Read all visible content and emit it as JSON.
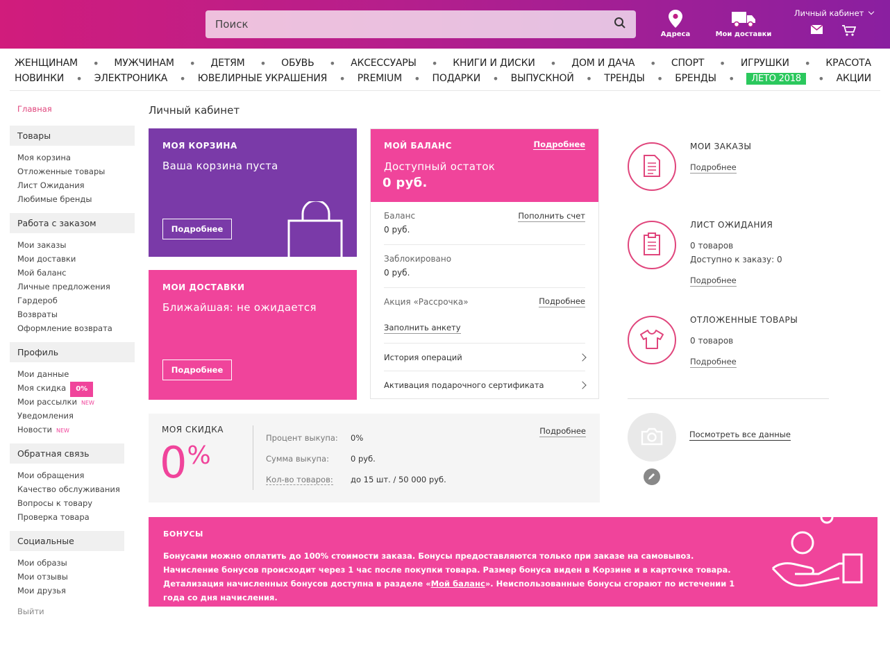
{
  "header": {
    "search_placeholder": "Поиск",
    "addresses_label": "Адреса",
    "deliveries_label": "Мои доставки",
    "account_label": "Личный кабинет"
  },
  "nav": {
    "row1": [
      "ЖЕНЩИНАМ",
      "МУЖЧИНАМ",
      "ДЕТЯМ",
      "ОБУВЬ",
      "АКСЕССУАРЫ",
      "КНИГИ И ДИСКИ",
      "ДОМ И ДАЧА",
      "СПОРТ",
      "ИГРУШКИ",
      "КРАСОТА"
    ],
    "row2": [
      "НОВИНКИ",
      "ЭЛЕКТРОНИКА",
      "ЮВЕЛИРНЫЕ УКРАШЕНИЯ",
      "PREMIUM",
      "ПОДАРКИ",
      "ВЫПУСКНОЙ",
      "ТРЕНДЫ",
      "БРЕНДЫ",
      "ЛЕТО 2018",
      "АКЦИИ"
    ]
  },
  "sidebar": {
    "home": "Главная",
    "sections": [
      {
        "title": "Товары",
        "items": [
          "Моя корзина",
          "Отложенные товары",
          "Лист Ожидания",
          "Любимые бренды"
        ]
      },
      {
        "title": "Работа с заказом",
        "items": [
          "Мои заказы",
          "Мои доставки",
          "Мой баланс",
          "Личные предложения",
          "Гардероб",
          "Возвраты",
          "Оформление возврата"
        ]
      },
      {
        "title": "Профиль",
        "items": [
          "Мои данные",
          "Моя скидка",
          "Мои рассылки",
          "Уведомления",
          "Новости"
        ]
      },
      {
        "title": "Обратная связь",
        "items": [
          "Мои обращения",
          "Качество обслуживания",
          "Вопросы к товару",
          "Проверка товара"
        ]
      },
      {
        "title": "Социальные",
        "items": [
          "Мои образы",
          "Мои отзывы",
          "Мои друзья"
        ]
      }
    ],
    "discount_badge": "0%",
    "new_tag": "NEW",
    "logout": "Выйти"
  },
  "page_title": "Личный кабинет",
  "cart": {
    "title": "МОЯ КОРЗИНА",
    "subtitle": "Ваша корзина пуста",
    "button": "Подробнее"
  },
  "deliveries": {
    "title": "МОИ ДОСТАВКИ",
    "subtitle": "Ближайшая: не ожидается",
    "button": "Подробнее"
  },
  "balance": {
    "title": "МОЙ БАЛАНС",
    "more": "Подробнее",
    "available_label": "Доступный остаток",
    "available_value": "0 руб.",
    "balance_label": "Баланс",
    "balance_value": "0 руб.",
    "topup": "Пополнить счет",
    "blocked_label": "Заблокировано",
    "blocked_value": "0 руб.",
    "promo_label": "Акция «Рассрочка»",
    "promo_more": "Подробнее",
    "promo_link": "Заполнить анкету",
    "history": "История операций",
    "gift": "Активация подарочного сертификата"
  },
  "discount": {
    "title": "МОЯ СКИДКА",
    "value": "0",
    "percent": "%",
    "more": "Подробнее",
    "rows": [
      {
        "label": "Процент выкупа:",
        "value": "0%"
      },
      {
        "label": "Сумма выкупа:",
        "value": "0 руб."
      },
      {
        "label": "Кол-во товаров:",
        "value": "до 15 шт. / 50 000 руб."
      }
    ]
  },
  "right": {
    "orders": {
      "title": "МОИ ЗАКАЗЫ",
      "more": "Подробнее"
    },
    "waitlist": {
      "title": "ЛИСТ ОЖИДАНИЯ",
      "count": "0 товаров",
      "available": "Доступно к заказу: 0",
      "more": "Подробнее"
    },
    "saved": {
      "title": "ОТЛОЖЕННЫЕ ТОВАРЫ",
      "count": "0 товаров",
      "more": "Подробнее"
    },
    "profile_link": "Посмотреть все данные"
  },
  "bonus": {
    "title": "БОНУСЫ",
    "text_before": "Бонусами можно оплатить до 100% стоимости заказа. Бонусы предоставляются только при заказе на самовывоз. Начисление бонусов происходит через 1 час после покупки товара. Размер бонуса виден в Корзине и в карточке товара. Детализация начисленных бонусов доступна в разделе «",
    "link": "Мой баланс",
    "text_after": "». Неиспользованные бонусы сгорают по истечении 1 года со дня начисления."
  },
  "colors": {
    "pink": "#f0449b",
    "purple": "#7a3aa8",
    "green": "#2bc85d",
    "header_from": "#d11c7c",
    "header_to": "#8a1fa0"
  }
}
